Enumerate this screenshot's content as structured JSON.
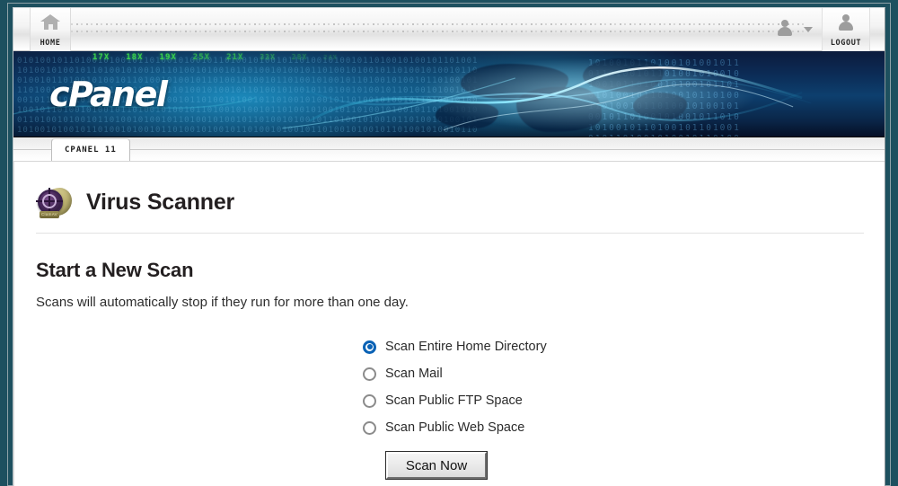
{
  "topbar": {
    "home_label": "HOME",
    "logout_label": "LOGOUT",
    "home_icon": "house-icon",
    "user_icon": "user-avatar-icon",
    "logout_icon": "user-logout-icon",
    "caret_icon": "chevron-down-icon"
  },
  "banner": {
    "logo_text": "cPanel",
    "green_ticks": [
      "17X",
      "18X",
      "19X",
      "25X",
      "21X",
      "33X",
      "28X",
      "24X"
    ],
    "binary_rows": "01010010110100101001011010010100101101001010010110100101001011010010100101101001\n10100101001011010010100101101001010010110100101001011010010100101101001010010110\n01001011010010100101101001010010110100101001011010010100101101001010010110100101\n11010010100101101001010010110100101001011010010100101101001010010110100101001011\n00101101001010010110100101001011010010100101101001010010110100101001011010010100\n10010110100101001011010010100101101001010010110100101001011010010100101101001010\n01101001010010110100101001011010010100101101001010010110100101001011010010100101\n10100101001011010010100101101001010010110100101001011010010100101101001010010110",
    "binary_rows_right": "1010010110100101001011\n0110100101101001010010\n1001011010010100101101\n0101001011010010110100\n1101001011010010100101\n0010110100101001011010\n1010010110100101101001\n0101101001010010110100"
  },
  "tabstrip": {
    "active_tab": "CPANEL 11"
  },
  "page": {
    "icon": "clamav-virus-scanner-icon",
    "title": "Virus Scanner",
    "section_title": "Start a New Scan",
    "section_description": "Scans will automatically stop if they run for more than one day.",
    "scan_options": [
      {
        "label": "Scan Entire Home Directory",
        "selected": true
      },
      {
        "label": "Scan Mail",
        "selected": false
      },
      {
        "label": "Scan Public FTP Space",
        "selected": false
      },
      {
        "label": "Scan Public Web Space",
        "selected": false
      }
    ],
    "scan_button_label": "Scan Now"
  },
  "colors": {
    "page_background": "#1d505f",
    "banner_dark": "#0b1b3c",
    "banner_cyan": "#25b6dc",
    "radio_accent": "#0a62b5",
    "tick_green": "#39d14a"
  }
}
